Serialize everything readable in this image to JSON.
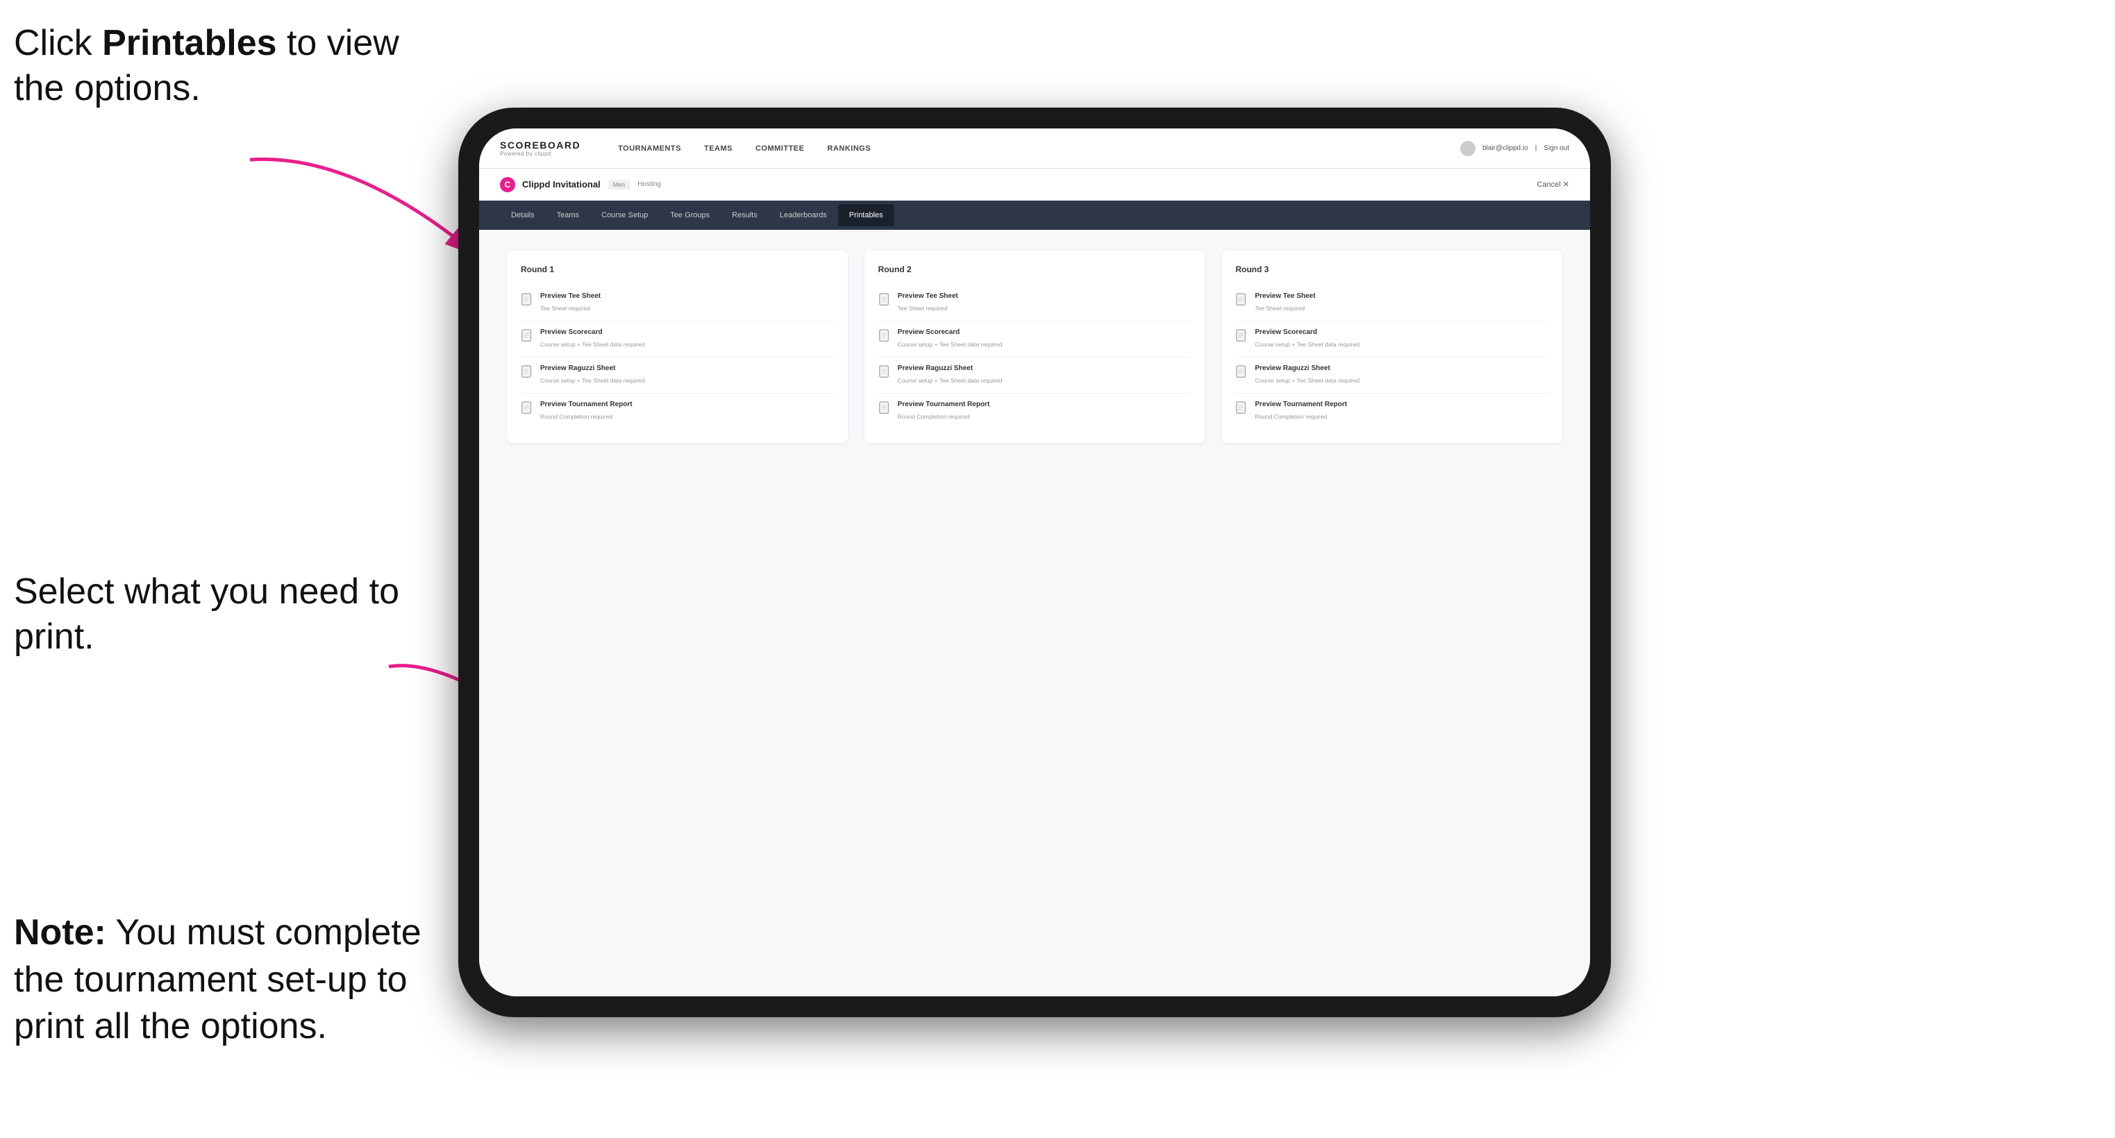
{
  "instructions": {
    "top": {
      "prefix": "Click ",
      "bold": "Printables",
      "suffix": " to view the options."
    },
    "middle": "Select what you need to print.",
    "bottom": {
      "bold": "Note:",
      "suffix": " You must complete the tournament set-up to print all the options."
    }
  },
  "nav": {
    "brand": "SCOREBOARD",
    "brand_sub": "Powered by clippd",
    "links": [
      "TOURNAMENTS",
      "TEAMS",
      "COMMITTEE",
      "RANKINGS"
    ],
    "user_email": "blair@clippd.io",
    "sign_out": "Sign out"
  },
  "tournament": {
    "logo": "C",
    "name": "Clippd Invitational",
    "badge": "Men",
    "status": "Hosting",
    "cancel": "Cancel ✕"
  },
  "sub_tabs": [
    "Details",
    "Teams",
    "Course Setup",
    "Tee Groups",
    "Results",
    "Leaderboards",
    "Printables"
  ],
  "active_tab": "Printables",
  "rounds": [
    {
      "title": "Round 1",
      "items": [
        {
          "label": "Preview Tee Sheet",
          "note": "Tee Sheet required"
        },
        {
          "label": "Preview Scorecard",
          "note": "Course setup + Tee Sheet data required"
        },
        {
          "label": "Preview Raguzzi Sheet",
          "note": "Course setup + Tee Sheet data required"
        },
        {
          "label": "Preview Tournament Report",
          "note": "Round Completion required"
        }
      ]
    },
    {
      "title": "Round 2",
      "items": [
        {
          "label": "Preview Tee Sheet",
          "note": "Tee Sheet required"
        },
        {
          "label": "Preview Scorecard",
          "note": "Course setup + Tee Sheet data required"
        },
        {
          "label": "Preview Raguzzi Sheet",
          "note": "Course setup + Tee Sheet data required"
        },
        {
          "label": "Preview Tournament Report",
          "note": "Round Completion required"
        }
      ]
    },
    {
      "title": "Round 3",
      "items": [
        {
          "label": "Preview Tee Sheet",
          "note": "Tee Sheet required"
        },
        {
          "label": "Preview Scorecard",
          "note": "Course setup + Tee Sheet data required"
        },
        {
          "label": "Preview Raguzzi Sheet",
          "note": "Course setup + Tee Sheet data required"
        },
        {
          "label": "Preview Tournament Report",
          "note": "Round Completion required"
        }
      ]
    }
  ]
}
